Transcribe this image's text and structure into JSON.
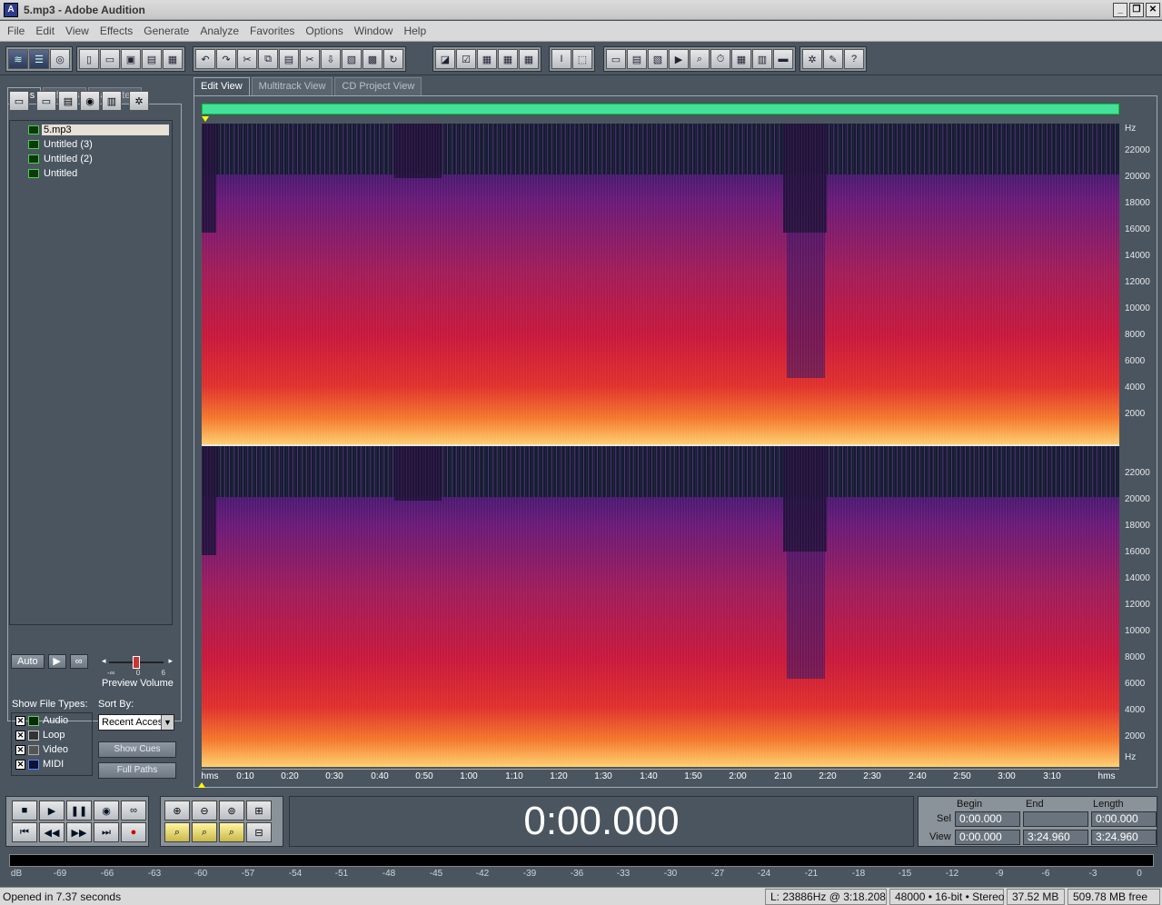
{
  "window": {
    "title": "5.mp3 - Adobe Audition"
  },
  "menu": [
    "File",
    "Edit",
    "View",
    "Effects",
    "Generate",
    "Analyze",
    "Favorites",
    "Options",
    "Window",
    "Help"
  ],
  "left_panel": {
    "tabs": [
      "Files",
      "Effects",
      "Favorites"
    ],
    "files": [
      "5.mp3",
      "Untitled (3)",
      "Untitled (2)",
      "Untitled"
    ],
    "auto_label": "Auto",
    "preview_volume_label": "Preview Volume",
    "slider_min": "-∞",
    "slider_mid": "0",
    "slider_max": "6",
    "show_types_label": "Show File Types:",
    "sort_label": "Sort By:",
    "types": [
      "Audio",
      "Loop",
      "Video",
      "MIDI"
    ],
    "sort_value": "Recent Access",
    "show_cues_label": "Show Cues",
    "full_paths_label": "Full Paths"
  },
  "view_tabs": [
    "Edit View",
    "Multitrack View",
    "CD Project View"
  ],
  "hz_axis": {
    "unit": "Hz",
    "ticks": [
      "22000",
      "20000",
      "18000",
      "16000",
      "14000",
      "12000",
      "10000",
      "8000",
      "6000",
      "4000",
      "2000"
    ]
  },
  "time_ruler": {
    "start_label": "hms",
    "end_label": "hms",
    "ticks": [
      "0:10",
      "0:20",
      "0:30",
      "0:40",
      "0:50",
      "1:00",
      "1:10",
      "1:20",
      "1:30",
      "1:40",
      "1:50",
      "2:00",
      "2:10",
      "2:20",
      "2:30",
      "2:40",
      "2:50",
      "3:00",
      "3:10"
    ]
  },
  "time_display": "0:00.000",
  "selection": {
    "headers": [
      "Begin",
      "End",
      "Length"
    ],
    "sel_label": "Sel",
    "view_label": "View",
    "sel_begin": "0:00.000",
    "sel_end": "",
    "sel_length": "0:00.000",
    "view_begin": "0:00.000",
    "view_end": "3:24.960",
    "view_length": "3:24.960"
  },
  "meter": {
    "unit": "dB",
    "ticks": [
      "-69",
      "-66",
      "-63",
      "-60",
      "-57",
      "-54",
      "-51",
      "-48",
      "-45",
      "-42",
      "-39",
      "-36",
      "-33",
      "-30",
      "-27",
      "-24",
      "-21",
      "-18",
      "-15",
      "-12",
      "-9",
      "-6",
      "-3",
      "0"
    ]
  },
  "status": {
    "message": "Opened in 7.37 seconds",
    "cursor": "L: 23886Hz @   3:18.208",
    "format": "48000 • 16-bit • Stereo",
    "size": "37.52 MB",
    "free": "509.78 MB free"
  },
  "colors": {
    "background": "#4a5560",
    "overview": "#45e09a",
    "spectrogram_low": "#ffd060",
    "spectrogram_mid": "#d0183a",
    "spectrogram_high": "#5a1a7a",
    "spectrogram_empty": "#141c30"
  }
}
